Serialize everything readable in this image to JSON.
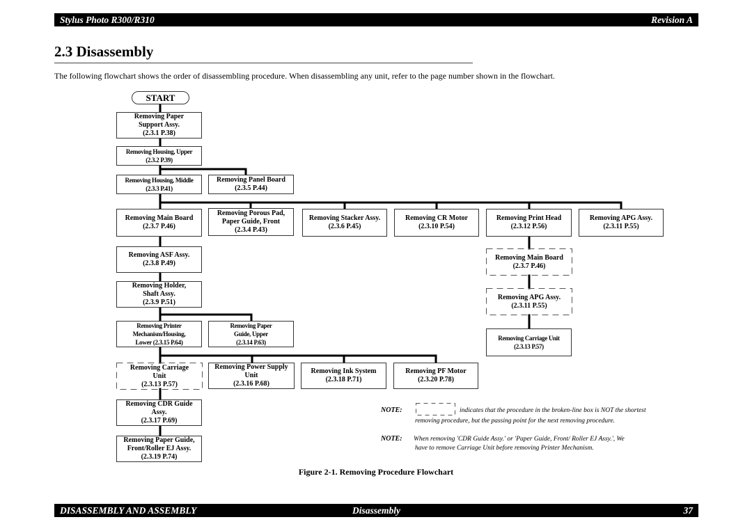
{
  "header": {
    "product": "Stylus Photo R300/R310",
    "revision": "Revision A"
  },
  "section": {
    "title": "2.3 Disassembly",
    "intro": "The following flowchart shows the order of disassembling procedure. When disassembling any unit, refer to the page number shown in the flowchart."
  },
  "flowchart": {
    "start": "START",
    "nodes": {
      "paper_support": {
        "lines": [
          "Removing Paper",
          "Support Assy.",
          "(2.3.1  P.38)"
        ],
        "dashed": false
      },
      "housing_upper": {
        "lines": [
          "Removing Housing, Upper",
          "(2.3.2 P.39)"
        ],
        "dashed": false
      },
      "housing_middle": {
        "lines": [
          "Removing Housing, Middle",
          "(2.3.3 P.41)"
        ],
        "dashed": false
      },
      "panel_board": {
        "lines": [
          "Removing Panel Board",
          "(2.3.5  P.44)"
        ],
        "dashed": false
      },
      "main_board": {
        "lines": [
          "Removing Main Board",
          "(2.3.7  P.46)"
        ],
        "dashed": false
      },
      "porous_pad": {
        "lines": [
          "Removing Porous Pad,",
          "Paper Guide, Front",
          "(2.3.4  P.43)"
        ],
        "dashed": false
      },
      "stacker": {
        "lines": [
          "Removing Stacker Assy.",
          "(2.3.6  P.45)"
        ],
        "dashed": false
      },
      "cr_motor": {
        "lines": [
          "Removing CR Motor",
          "(2.3.10  P.54)"
        ],
        "dashed": false
      },
      "print_head": {
        "lines": [
          "Removing Print Head",
          "(2.3.12  P.56)"
        ],
        "dashed": false
      },
      "apg_top": {
        "lines": [
          "Removing APG Assy.",
          "(2.3.11  P.55)"
        ],
        "dashed": false
      },
      "asf": {
        "lines": [
          "Removing ASF Assy.",
          "(2.3.8  P.49)"
        ],
        "dashed": false
      },
      "holder_shaft": {
        "lines": [
          "Removing Holder,",
          "Shaft Assy.",
          "(2.3.9  P.51)"
        ],
        "dashed": false
      },
      "printer_mech": {
        "lines": [
          "Removing Printer",
          "Mechanism/Housing,",
          "Lower  (2.3.15  P.64)"
        ],
        "dashed": false
      },
      "paper_guide_upper": {
        "lines": [
          "Removing Paper",
          "Guide, Upper",
          "(2.3.14  P.63)"
        ],
        "dashed": false
      },
      "carriage_left": {
        "lines": [
          "Removing Carriage",
          "Unit",
          "(2.3.13  P.57)"
        ],
        "dashed": true
      },
      "power_supply": {
        "lines": [
          "Removing Power Supply",
          "Unit",
          "(2.3.16  P.68)"
        ],
        "dashed": false
      },
      "ink_system": {
        "lines": [
          "Removing Ink System",
          "(2.3.18  P.71)"
        ],
        "dashed": false
      },
      "pf_motor": {
        "lines": [
          "Removing PF Motor",
          "(2.3.20  P.78)"
        ],
        "dashed": false
      },
      "cdr_guide": {
        "lines": [
          "Removing CDR Guide",
          "Assy.",
          "(2.3.17  P.69)"
        ],
        "dashed": false
      },
      "paper_guide_front": {
        "lines": [
          "Removing Paper Guide,",
          "Front/Roller EJ Assy.",
          "(2.3.19  P.74)"
        ],
        "dashed": false
      },
      "main_board_right": {
        "lines": [
          "Removing Main Board",
          "(2.3.7  P.46)"
        ],
        "dashed": true
      },
      "apg_right": {
        "lines": [
          "Removing APG Assy.",
          "(2.3.11  P.55)"
        ],
        "dashed": true
      },
      "carriage_right": {
        "lines": [
          "Removing Carriage Unit",
          "(2.3.13  P.57)"
        ],
        "dashed": false
      }
    }
  },
  "notes": [
    {
      "label": "NOTE:",
      "text": "indicates that the procedure in the broken-line box is NOT the shortest",
      "text2": "removing procedure, but the passing point for the next removing procedure."
    },
    {
      "label": "NOTE:",
      "text": " When removing 'CDR Guide Assy.' or 'Paper Guide, Front/ Roller EJ Assy.', We",
      "text2": "have to remove Carriage Unit before removing Printer Mechanism."
    }
  ],
  "caption": "Figure 2-1.  Removing Procedure Flowchart",
  "footer": {
    "chapter": "DISASSEMBLY AND ASSEMBLY",
    "section": "Disassembly",
    "page": "37"
  }
}
